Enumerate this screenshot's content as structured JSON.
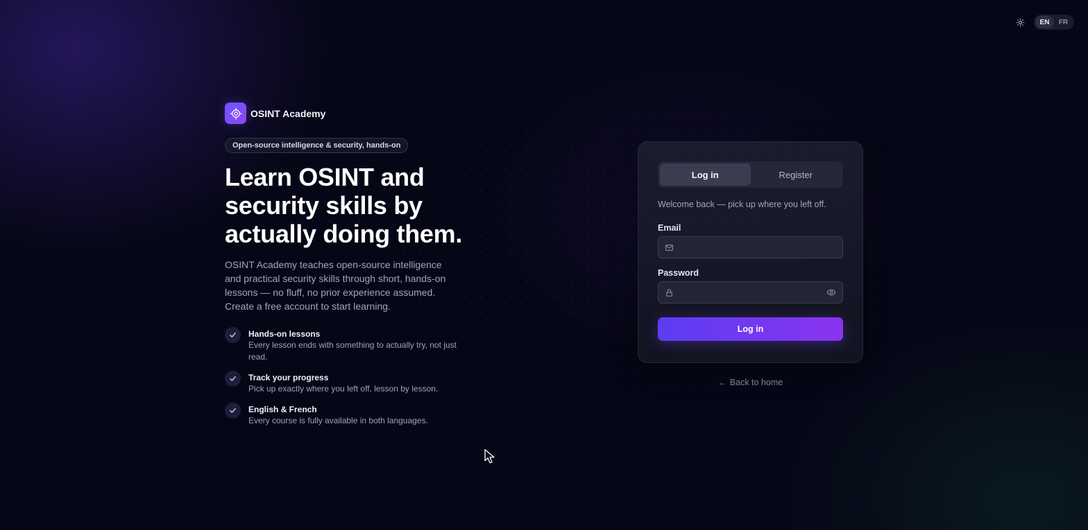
{
  "header": {
    "theme_icon": "sun-icon",
    "languages": [
      "EN",
      "FR"
    ],
    "active_language": "EN"
  },
  "brand": {
    "name": "OSINT Academy",
    "logo_icon": "target-icon",
    "logo_color": "#6d55ff"
  },
  "hero": {
    "tagline": "Open-source intelligence & security, hands-on",
    "headline_line1": "Learn OSINT and",
    "headline_line2": "security skills by",
    "headline_line3": "actually doing them.",
    "intro": "OSINT Academy teaches open-source intelligence and practical security skills through short, hands-on lessons — no fluff, no prior experience assumed. Create a free account to start learning."
  },
  "features": [
    {
      "title": "Hands-on lessons",
      "description": "Every lesson ends with something to actually try, not just read."
    },
    {
      "title": "Track your progress",
      "description": "Pick up exactly where you left off, lesson by lesson."
    },
    {
      "title": "English & French",
      "description": "Every course is fully available in both languages."
    }
  ],
  "auth": {
    "tabs": [
      "Log in",
      "Register"
    ],
    "active_tab": "Log in",
    "welcome": "Welcome back — pick up where you left off.",
    "email_label": "Email",
    "email_value": "",
    "email_placeholder": "",
    "password_label": "Password",
    "password_value": "",
    "password_placeholder": "",
    "submit_label": "Log in",
    "accent_color": "#5b3df2"
  },
  "footer_link": {
    "label": "Back to home",
    "icon": "arrow-left-icon"
  }
}
